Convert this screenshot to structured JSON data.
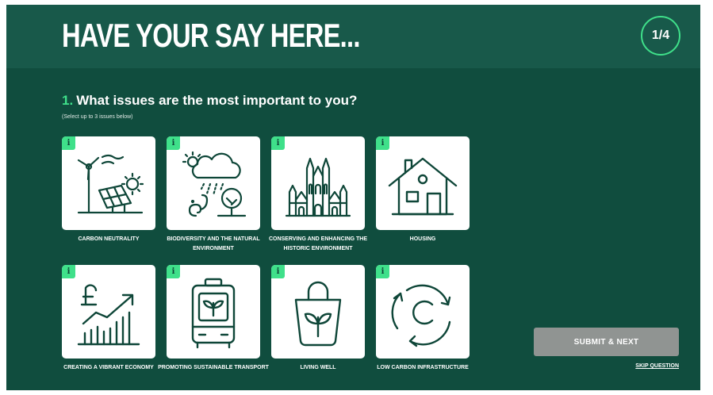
{
  "header": {
    "title": "HAVE YOUR SAY HERE...",
    "step": "1/4"
  },
  "question": {
    "number": "1.",
    "text": "What issues are the most important to you?",
    "hint": "(Select up to 3 issues below)"
  },
  "info_glyph": "i",
  "issues": [
    {
      "label": "CARBON NEUTRALITY",
      "icon": "wind-turbine-solar-panel-icon"
    },
    {
      "label": "BIODIVERSITY AND THE NATURAL ENVIRONMENT",
      "icon": "weather-tree-squirrel-icon"
    },
    {
      "label": "CONSERVING AND ENHANCING THE HISTORIC ENVIRONMENT",
      "icon": "cathedral-icon"
    },
    {
      "label": "HOUSING",
      "icon": "house-icon"
    },
    {
      "label": "CREATING A VIBRANT ECONOMY",
      "icon": "pound-growth-chart-icon"
    },
    {
      "label": "PROMOTING SUSTAINABLE TRANSPORT",
      "icon": "eco-tram-icon"
    },
    {
      "label": "LIVING WELL",
      "icon": "leaf-shopping-bag-icon"
    },
    {
      "label": "LOW CARBON INFRASTRUCTURE",
      "icon": "carbon-recycle-icon"
    }
  ],
  "actions": {
    "submit": "SUBMIT & NEXT",
    "skip": "SKIP QUESTION"
  },
  "colors": {
    "background": "#104d3e",
    "header": "#18594a",
    "accent": "#3fe08a",
    "button": "#909492",
    "icon_stroke": "#0e4638"
  }
}
